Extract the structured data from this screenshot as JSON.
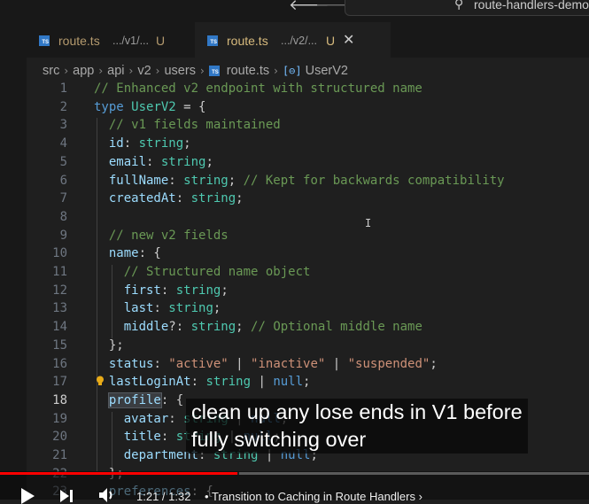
{
  "titlebar": {
    "back_arrow": "🡐",
    "forward_arrow": "🡒",
    "command_center_text": "route-handlers-demo",
    "search_glyph": "⚲"
  },
  "tabs": [
    {
      "name": "route.ts",
      "description": ".../v1/...",
      "status": "U",
      "active": false
    },
    {
      "name": "route.ts",
      "description": ".../v2/...",
      "status": "U",
      "active": true,
      "close": "✕"
    }
  ],
  "breadcrumb": {
    "segments": [
      "src",
      "app",
      "api",
      "v2",
      "users"
    ],
    "file": "route.ts",
    "symbol_icon": "[⊖]",
    "symbol": "UserV2",
    "separator": "›"
  },
  "editor": {
    "current_line": 18,
    "lines": [
      {
        "n": "1",
        "text": "// Enhanced v2 endpoint with structured name"
      },
      {
        "n": "2",
        "text": "type UserV2 = {"
      },
      {
        "n": "3",
        "text": "  // v1 fields maintained"
      },
      {
        "n": "4",
        "text": "  id: string;"
      },
      {
        "n": "5",
        "text": "  email: string;"
      },
      {
        "n": "6",
        "text": "  fullName: string; // Kept for backwards compatibility"
      },
      {
        "n": "7",
        "text": "  createdAt: string;"
      },
      {
        "n": "8",
        "text": ""
      },
      {
        "n": "9",
        "text": "  // new v2 fields"
      },
      {
        "n": "10",
        "text": "  name: {"
      },
      {
        "n": "11",
        "text": "    // Structured name object"
      },
      {
        "n": "12",
        "text": "    first: string;"
      },
      {
        "n": "13",
        "text": "    last: string;"
      },
      {
        "n": "14",
        "text": "    middle?: string; // Optional middle name"
      },
      {
        "n": "15",
        "text": "  };"
      },
      {
        "n": "16",
        "text": "  status: \"active\" | \"inactive\" | \"suspended\";"
      },
      {
        "n": "17",
        "text": "  lastLoginAt: string | null;"
      },
      {
        "n": "18",
        "text": "  profile: {"
      },
      {
        "n": "19",
        "text": "    avatar: string | null;"
      },
      {
        "n": "20",
        "text": "    title: string | null;"
      },
      {
        "n": "21",
        "text": "    department: string | null;"
      },
      {
        "n": "22",
        "text": "  };"
      },
      {
        "n": "23",
        "text": "  preferences: {"
      }
    ]
  },
  "caption": {
    "line1": "clean up any lose ends in V1 before",
    "line2": "fully switching over"
  },
  "video": {
    "time": "1:21 / 1:32",
    "separator": "•",
    "chapter": "Transition to Caching in Route Handlers",
    "chapter_arrow": "›",
    "progress_percent": 40.5,
    "colors": {
      "progress": "#ff0000"
    }
  },
  "colors": {
    "editor_bg": "#1f1f1f",
    "comment": "#6a9955",
    "keyword": "#569cd6",
    "type": "#4ec9b0",
    "property": "#9cdcfe",
    "string": "#ce9178",
    "ts_badge": "#3178c6",
    "modified": "#d7ba7d"
  }
}
